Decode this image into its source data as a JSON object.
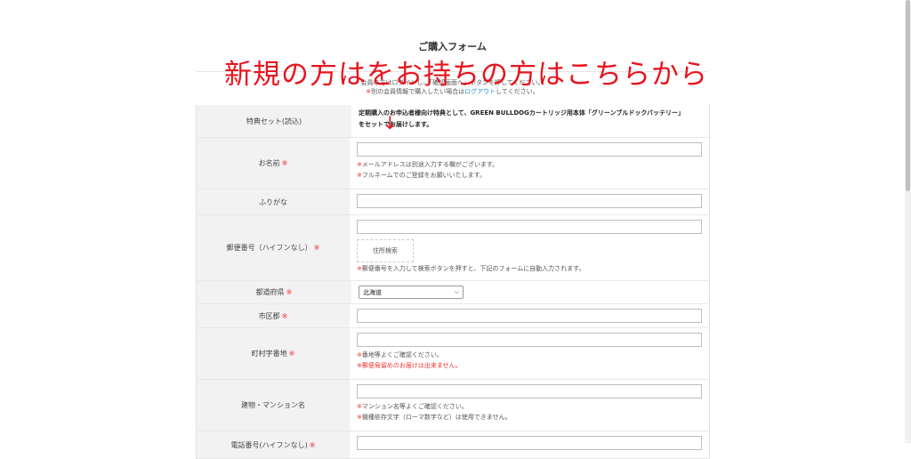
{
  "page_title": "ご購入フォーム",
  "notices": {
    "line1": "会員の方はログインし、「確認画面へ」ボタンを押してください。",
    "line2_prefix": "別の会員情報で購入したい場合は",
    "line2_link": "ログアウト",
    "line2_suffix": "してください。",
    "asterisk": "※"
  },
  "overlay": {
    "text": "新規の方はをお持ちの方はこちらから",
    "arrow": "↓"
  },
  "intro": {
    "label": "特典セット(読込)",
    "text_line1": "定期購入のお申込者様向け特典として、GREEN BULLDOGカートリッジ用本体「グリーンブルドックバッテリー」",
    "text_line2": "をセットでお届けします。"
  },
  "fields": {
    "name": {
      "label": "お名前",
      "req": "※",
      "note1": "メールアドレスは別途入力する欄がございます。",
      "note2": "フルネームでのご登録をお願いいたします。"
    },
    "kana": {
      "label": "ふりがな"
    },
    "zip": {
      "label": "郵便番号（ハイフンなし）",
      "req": "※",
      "button": "住所検索",
      "note": "郵便番号を入力して検索ボタンを押すと、下記のフォームに自動入力されます。"
    },
    "pref": {
      "label": "都道府県",
      "req": "※",
      "value": "北海道"
    },
    "city": {
      "label": "市区郡",
      "req": "※"
    },
    "address": {
      "label": "町村字番地",
      "req": "※",
      "note1": "番地等よくご確認ください。",
      "note2": "郵便局留めのお届けは出来ません。"
    },
    "building": {
      "label": "建物・マンション名",
      "note1": "マンション名等よくご確認ください。",
      "note2": "機種依存文字（ローマ数字など）は使用できません。"
    },
    "phone": {
      "label": "電話番号(ハイフンなし)",
      "req": "※"
    }
  },
  "colors": {
    "accent_red": "#e8141e",
    "link_blue": "#1a8fd6",
    "label_bg": "#f2f2f2"
  }
}
